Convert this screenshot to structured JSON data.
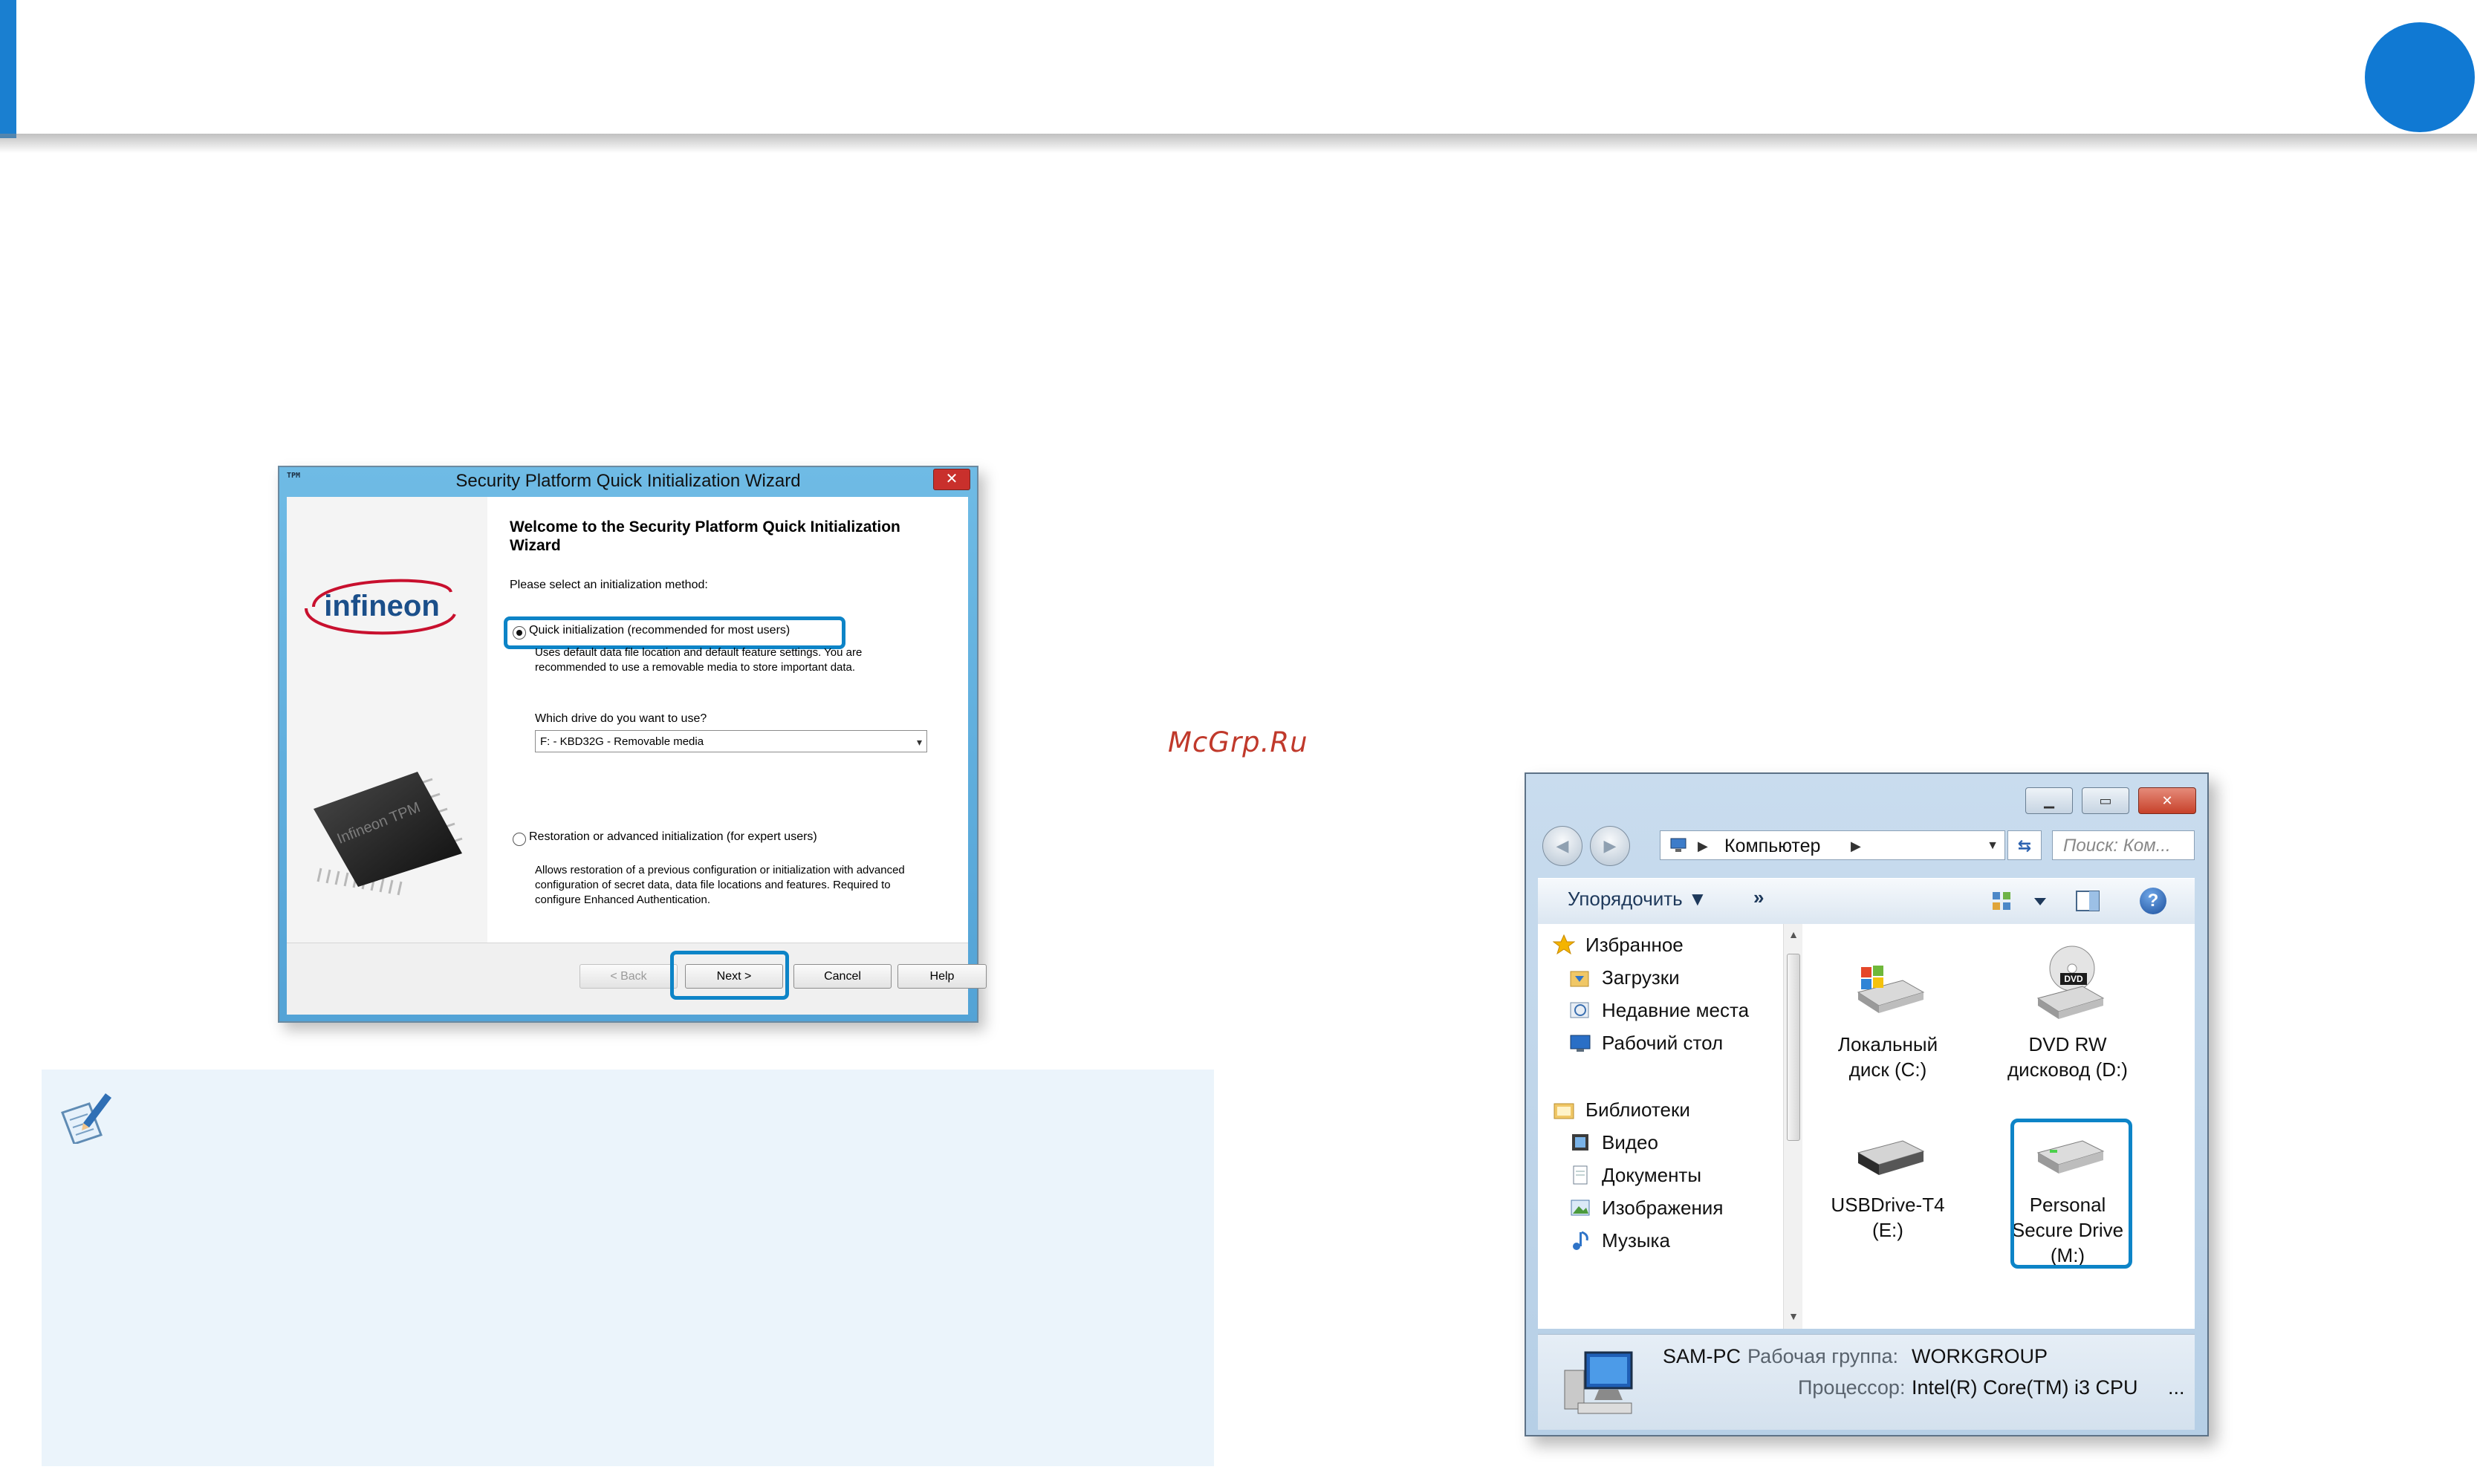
{
  "watermark": "McGrp.Ru",
  "wizard": {
    "app_icon": "TPM",
    "title": "Security Platform Quick Initialization Wizard",
    "close_glyph": "✕",
    "logo_text": "infineon",
    "chip_text": "Infineon TPM",
    "heading": "Welcome to the Security Platform Quick Initialization Wizard",
    "prompt": "Please select an initialization method:",
    "option1": {
      "label": "Quick initialization (recommended for most users)",
      "selected": true,
      "description": "Uses default data file location and default feature settings. You are recommended to use a removable media to store important data."
    },
    "drive_question": "Which drive do you want to use?",
    "drive_value": "F: - KBD32G - Removable media",
    "option2": {
      "label": "Restoration or advanced initialization (for expert users)",
      "selected": false,
      "description": "Allows restoration of a previous configuration or initialization with advanced configuration of secret data, data file locations and features. Required to configure Enhanced Authentication."
    },
    "buttons": {
      "back": "< Back",
      "next": "Next >",
      "cancel": "Cancel",
      "help": "Help"
    }
  },
  "explorer": {
    "address": "Компьютер",
    "search_placeholder": "Поиск: Ком...",
    "toolbar": {
      "organize": "Упорядочить ▼",
      "more": "»"
    },
    "nav": [
      {
        "label": "Избранное",
        "icon": "star-icon"
      },
      {
        "label": "Загрузки",
        "icon": "downloads-folder-icon"
      },
      {
        "label": "Недавние места",
        "icon": "recent-places-icon"
      },
      {
        "label": "Рабочий стол",
        "icon": "desktop-icon"
      },
      {
        "label": "Библиотеки",
        "icon": "libraries-icon"
      },
      {
        "label": "Видео",
        "icon": "video-icon"
      },
      {
        "label": "Документы",
        "icon": "documents-icon"
      },
      {
        "label": "Изображения",
        "icon": "pictures-icon"
      },
      {
        "label": "Музыка",
        "icon": "music-icon"
      }
    ],
    "drives": [
      {
        "label": "Локальный диск (C:)",
        "icon": "local-disk-icon"
      },
      {
        "label": "DVD RW дисковод (D:)",
        "icon": "dvd-drive-icon",
        "badge": "DVD"
      },
      {
        "label": "USBDrive-T4 (E:)",
        "icon": "usb-drive-icon"
      },
      {
        "label": "Personal Secure Drive (M:)",
        "icon": "secure-drive-icon",
        "highlighted": true
      }
    ],
    "status": {
      "pc_name": "SAM-PC",
      "workgroup_label": "Рабочая группа:",
      "workgroup_value": "WORKGROUP",
      "cpu_label": "Процессор:",
      "cpu_value": "Intel(R) Core(TM) i3 CPU",
      "ellipsis": "..."
    }
  },
  "colors": {
    "accent": "#1079d3",
    "highlight": "#0d84c7",
    "note_bg": "#ebf4fb"
  }
}
